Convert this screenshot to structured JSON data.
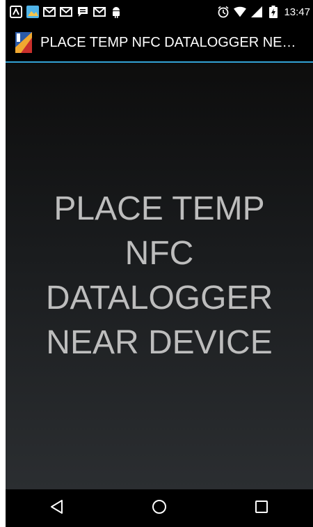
{
  "status_bar": {
    "left_icons": [
      "caliper-app-icon",
      "photo-app-icon",
      "gmail-icon",
      "gmail-icon",
      "chat-icon",
      "gmail-icon",
      "android-icon"
    ],
    "right_icons": [
      "alarm-icon",
      "wifi-icon",
      "signal-icon",
      "battery-charging-icon"
    ],
    "time": "13:47"
  },
  "action_bar": {
    "title": "PLACE TEMP NFC DATALOGGER NEAR..."
  },
  "main": {
    "message_lines": [
      "PLACE TEMP",
      "NFC",
      "DATALOGGER",
      "NEAR DEVICE"
    ]
  },
  "nav_bar": {
    "buttons": [
      "back-icon",
      "home-icon",
      "recents-icon"
    ]
  },
  "colors": {
    "accent": "#33a3d6",
    "message_text": "#bdbdbd"
  }
}
